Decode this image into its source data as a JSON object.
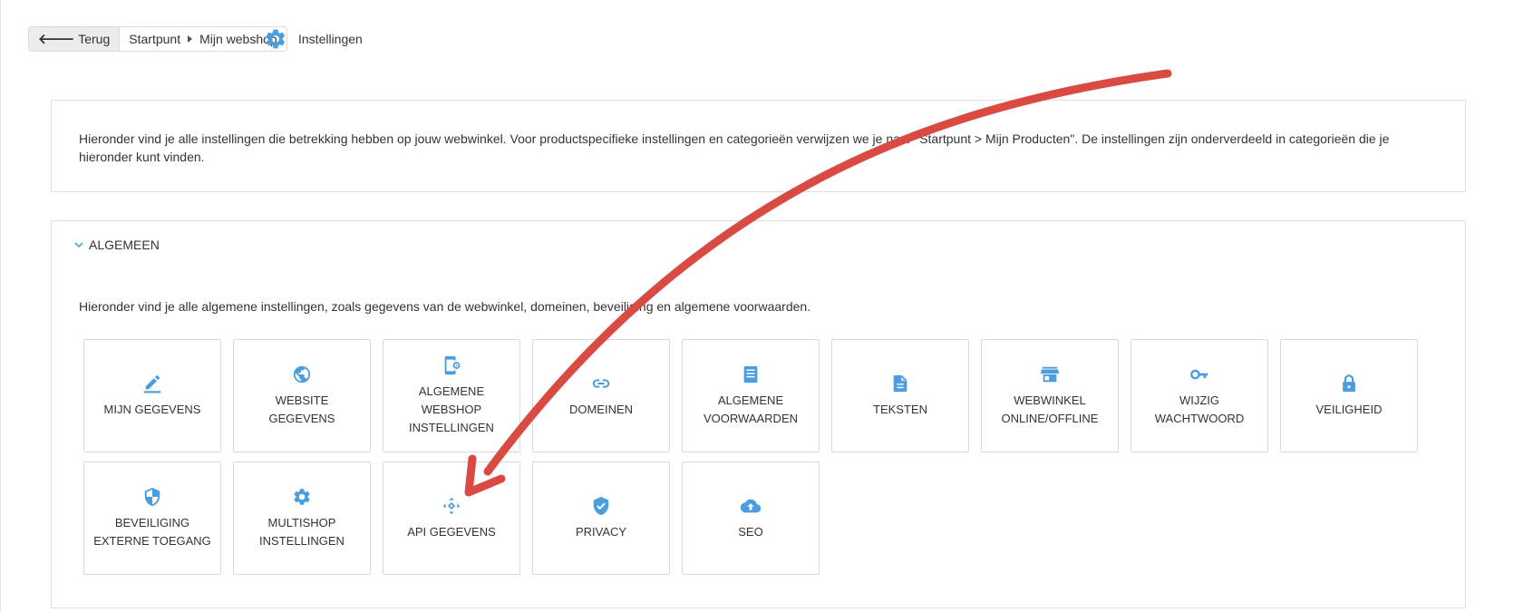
{
  "header": {
    "back_label": "Terug",
    "breadcrumb": [
      "Startpunt",
      "Mijn webshop"
    ],
    "title": "Instellingen"
  },
  "intro": {
    "text": "Hieronder vind je alle instellingen die betrekking hebben op jouw webwinkel. Voor productspecifieke instellingen en categorieën verwijzen we je naar \"Startpunt > Mijn Producten\". De instellingen zijn onderverdeeld in categorieën die je hieronder kunt vinden."
  },
  "section": {
    "title": "ALGEMEEN",
    "description": "Hieronder vind je alle algemene instellingen, zoals gegevens van de webwinkel, domeinen, beveiliging en algemene voorwaarden.",
    "tiles": [
      {
        "label": "MIJN GEGEVENS",
        "icon": "pencil-icon"
      },
      {
        "label": "WEBSITE GEGEVENS",
        "icon": "globe-icon"
      },
      {
        "label": "ALGEMENE WEBSHOP INSTELLINGEN",
        "icon": "phone-settings-icon"
      },
      {
        "label": "DOMEINEN",
        "icon": "link-icon"
      },
      {
        "label": "ALGEMENE VOORWAARDEN",
        "icon": "document-list-icon"
      },
      {
        "label": "TEKSTEN",
        "icon": "text-file-icon"
      },
      {
        "label": "WEBWINKEL ONLINE/OFFLINE",
        "icon": "storefront-icon"
      },
      {
        "label": "WIJZIG WACHTWOORD",
        "icon": "key-icon"
      },
      {
        "label": "VEILIGHEID",
        "icon": "lock-icon"
      },
      {
        "label": "BEVEILIGING EXTERNE TOEGANG",
        "icon": "shield-icon"
      },
      {
        "label": "MULTISHOP INSTELLINGEN",
        "icon": "gear-icon"
      },
      {
        "label": "API GEGEVENS",
        "icon": "api-icon"
      },
      {
        "label": "PRIVACY",
        "icon": "verified-shield-icon"
      },
      {
        "label": "SEO",
        "icon": "cloud-upload-icon"
      }
    ]
  },
  "colors": {
    "accent": "#4a9ee0",
    "annotation": "#d94a42"
  }
}
